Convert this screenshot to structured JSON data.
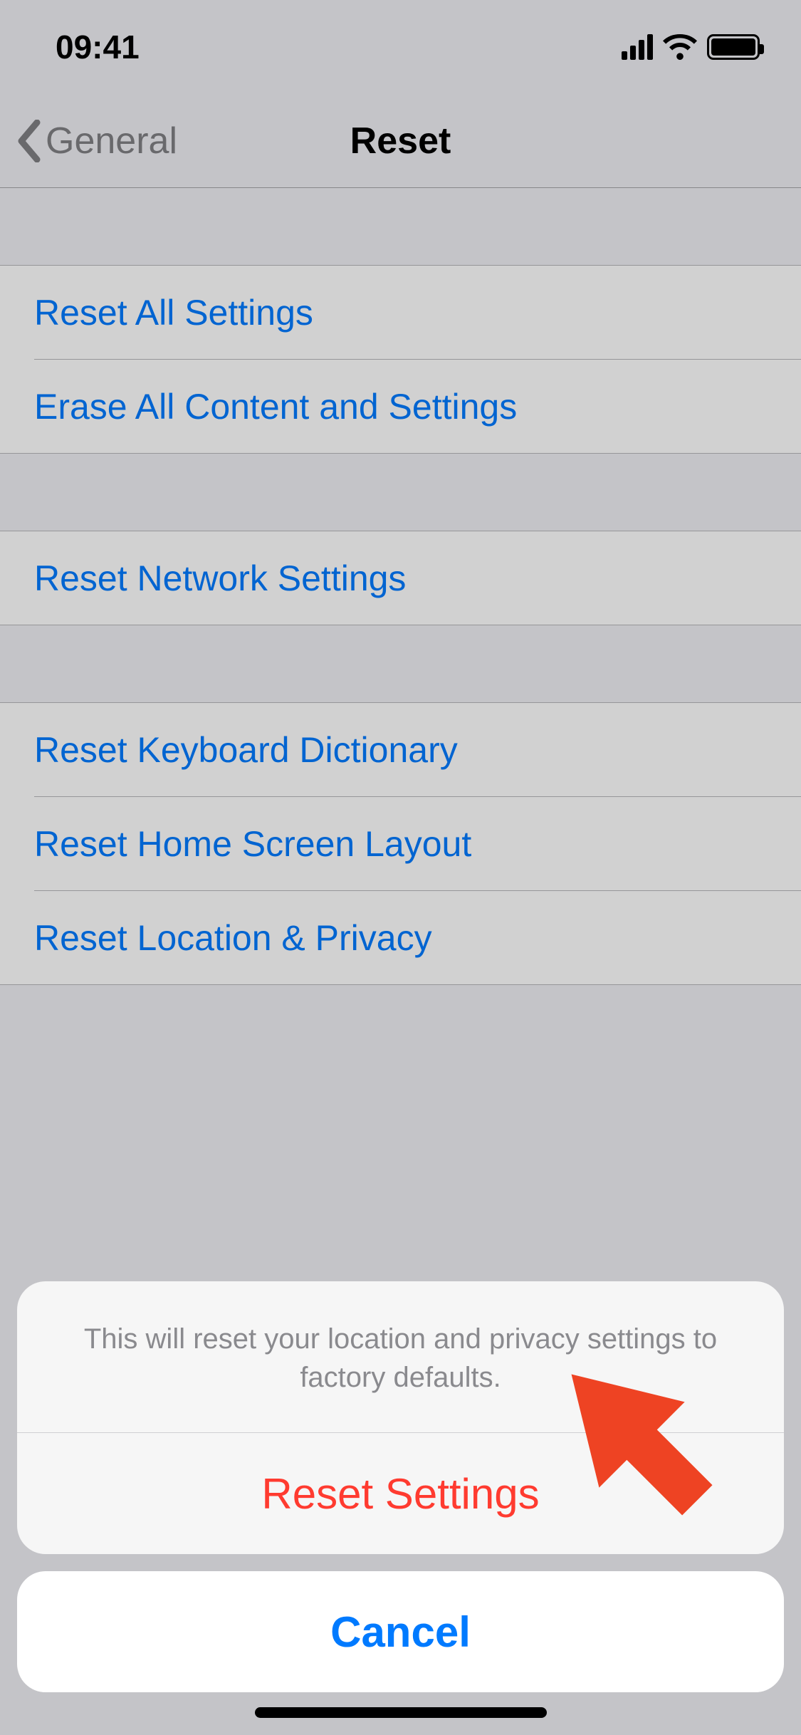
{
  "status": {
    "time": "09:41"
  },
  "nav": {
    "back_label": "General",
    "title": "Reset"
  },
  "groups": {
    "g1": {
      "r1": "Reset All Settings",
      "r2": "Erase All Content and Settings"
    },
    "g2": {
      "r1": "Reset Network Settings"
    },
    "g3": {
      "r1": "Reset Keyboard Dictionary",
      "r2": "Reset Home Screen Layout",
      "r3": "Reset Location & Privacy"
    }
  },
  "sheet": {
    "message": "This will reset your location and privacy settings to factory defaults.",
    "action": "Reset Settings",
    "cancel": "Cancel"
  }
}
